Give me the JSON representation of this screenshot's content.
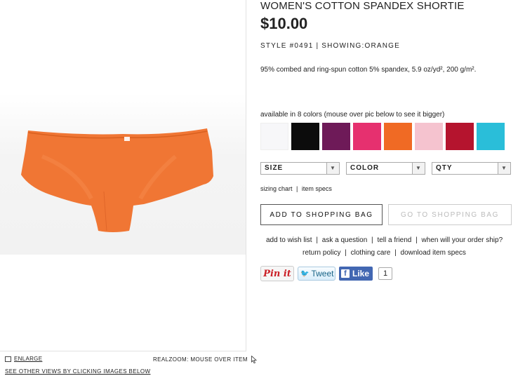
{
  "product": {
    "title": "WOMEN'S COTTON SPANDEX SHORTIE",
    "price": "$10.00",
    "style_line": "STYLE #0491 | SHOWING:ORANGE",
    "description": "95% combed and ring-spun cotton 5% spandex, 5.9 oz/yd², 200 g/m²."
  },
  "colors": {
    "label": "available in 8 colors (mouse over pic below to see it bigger)",
    "swatches": [
      "#f7f7f9",
      "#0c0c0c",
      "#6e1a58",
      "#e6306f",
      "#f06a24",
      "#f5c3cf",
      "#b5142e",
      "#2abed9"
    ]
  },
  "image_panel": {
    "enlarge": "ENLARGE",
    "realzoom": "REALZOOM: MOUSE OVER ITEM",
    "see_other": "SEE OTHER VIEWS BY CLICKING IMAGES BELOW",
    "product_color": "#f07634"
  },
  "selects": {
    "size": "SIZE",
    "color": "COLOR",
    "qty": "QTY"
  },
  "links": {
    "sizing_chart": "sizing chart",
    "item_specs": "item specs",
    "add_to_wish_list": "add to wish list",
    "ask_a_question": "ask a question",
    "tell_a_friend": "tell a friend",
    "when_ship": "when will your order ship?",
    "return_policy": "return policy",
    "clothing_care": "clothing care",
    "download_specs": "download item specs",
    "sep": "|"
  },
  "buttons": {
    "add_to_bag": "ADD TO SHOPPING BAG",
    "go_to_bag": "GO TO SHOPPING BAG"
  },
  "social": {
    "pin_it": "Pin it",
    "tweet": "Tweet",
    "like": "Like",
    "like_count": "1"
  }
}
